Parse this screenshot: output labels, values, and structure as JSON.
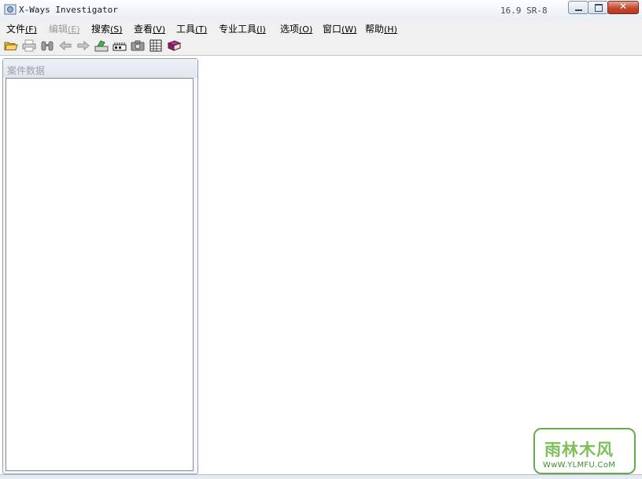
{
  "window": {
    "title": "X-Ways Investigator",
    "version": "16.9 SR-8",
    "close_glyph": "✕"
  },
  "menu": [
    {
      "label": "文件",
      "accel": "(F)",
      "enabled": true
    },
    {
      "label": "编辑",
      "accel": "(E)",
      "enabled": false
    },
    {
      "label": "搜索",
      "accel": "(S)",
      "enabled": true
    },
    {
      "label": "查看",
      "accel": "(V)",
      "enabled": true
    },
    {
      "label": "工具",
      "accel": "(T)",
      "enabled": true
    },
    {
      "label": "专业工具",
      "accel": "(I)",
      "enabled": true
    },
    {
      "label": "选项",
      "accel": "(O)",
      "enabled": true
    },
    {
      "label": "窗口",
      "accel": "(W)",
      "enabled": true
    },
    {
      "label": "帮助",
      "accel": "(H)",
      "enabled": true
    }
  ],
  "toolbar": {
    "icons": [
      "open-folder-icon",
      "print-icon",
      "binoculars-icon",
      "back-arrow-icon",
      "forward-arrow-icon",
      "disk-editor-icon",
      "ram-chip-icon",
      "camera-icon",
      "calculator-icon",
      "book-icon"
    ]
  },
  "case_panel": {
    "title": "案件数据"
  },
  "watermark": {
    "logo": "雨林木风",
    "url": "WwW.YLMFU.CoM"
  }
}
